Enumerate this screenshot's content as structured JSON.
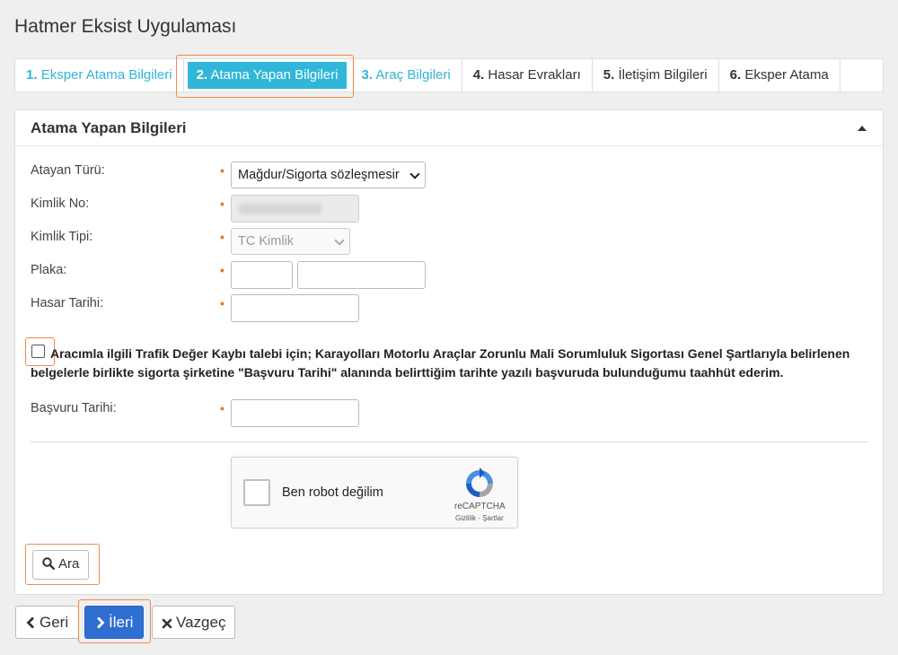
{
  "app": {
    "title": "Hatmer Eksist Uygulaması"
  },
  "tabs": [
    {
      "num": "1.",
      "label": "Eksper Atama Bilgileri",
      "state": "done"
    },
    {
      "num": "2.",
      "label": "Atama Yapan Bilgileri",
      "state": "active"
    },
    {
      "num": "3.",
      "label": "Araç Bilgileri",
      "state": "done"
    },
    {
      "num": "4.",
      "label": "Hasar Evrakları",
      "state": "todo"
    },
    {
      "num": "5.",
      "label": "İletişim Bilgileri",
      "state": "todo"
    },
    {
      "num": "6.",
      "label": "Eksper Atama",
      "state": "todo"
    }
  ],
  "panel": {
    "title": "Atama Yapan Bilgileri",
    "required_mark": "•",
    "fields": {
      "atayan_turu": {
        "label": "Atayan Türü:",
        "value": "Mağdur/Sigorta sözleşmesir"
      },
      "kimlik_no": {
        "label": "Kimlik No:",
        "value": ""
      },
      "kimlik_tipi": {
        "label": "Kimlik Tipi:",
        "value": "TC Kimlik"
      },
      "plaka": {
        "label": "Plaka:",
        "value_1": "",
        "value_2": ""
      },
      "hasar_tarihi": {
        "label": "Hasar Tarihi:",
        "value": ""
      },
      "basvuru_tarihi": {
        "label": "Başvuru Tarihi:",
        "value": ""
      }
    },
    "consent_text": "Aracımla ilgili Trafik Değer Kaybı talebi için; Karayolları Motorlu Araçlar Zorunlu Mali Sorumluluk Sigortası Genel Şartlarıyla belirlenen belgelerle birlikte sigorta şirketine \"Başvuru Tarihi\" alanında belirttiğim tarihte yazılı başvuruda bulunduğumu taahhüt ederim.",
    "recaptcha": {
      "label": "Ben robot değilim",
      "brand": "reCAPTCHA",
      "links": "Gizlilik - Şartlar"
    },
    "search_button": "Ara"
  },
  "footer": {
    "back_button": "Geri",
    "next_button": "İleri",
    "cancel_button": "Vazgeç"
  },
  "colors": {
    "accent": "#2fb6d8",
    "primary": "#2f6fd1",
    "highlight": "#f08a4b",
    "required": "#e07b24"
  }
}
